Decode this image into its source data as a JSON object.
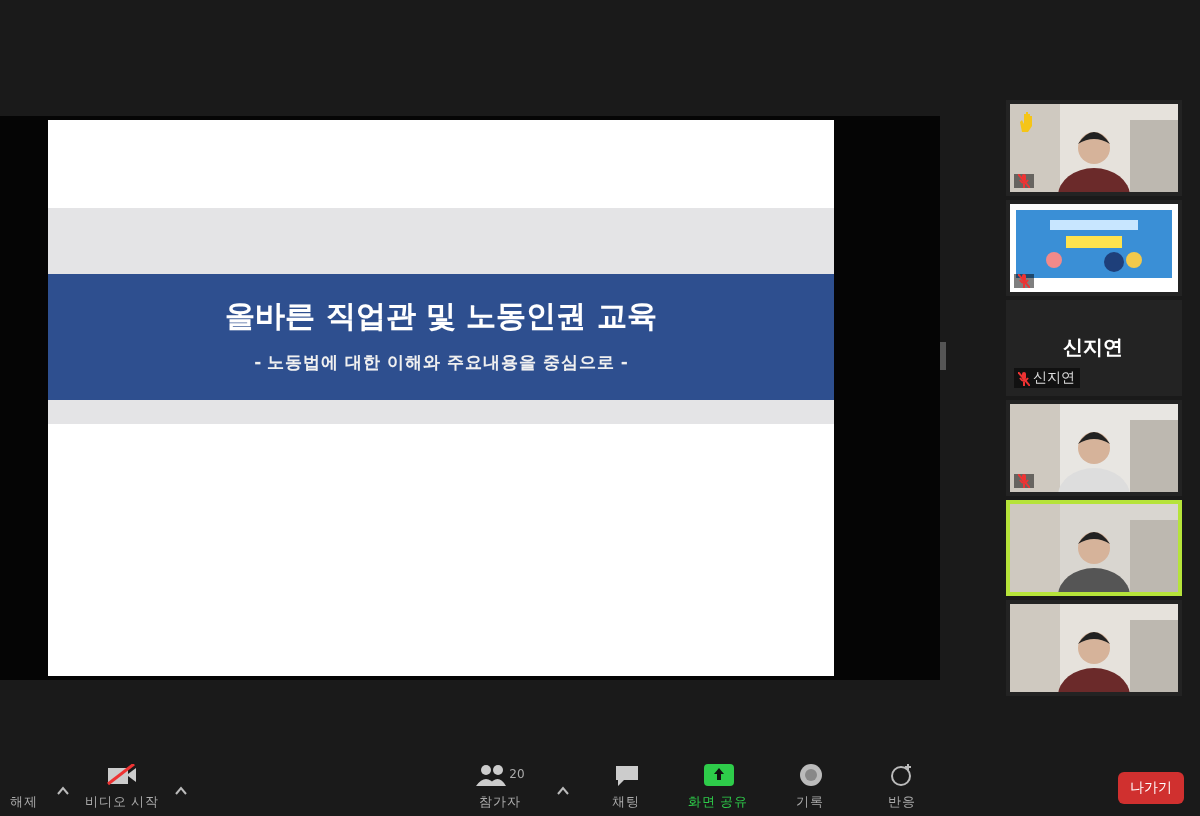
{
  "slide": {
    "title": "올바른 직업관 및 노동인권 교육",
    "subtitle": "- 노동법에 대한 이해와 주요내용을 중심으로 -"
  },
  "participants": [
    {
      "kind": "video",
      "raised_hand": true,
      "muted": true,
      "active_speaker": false
    },
    {
      "kind": "screen",
      "raised_hand": false,
      "muted": true,
      "active_speaker": false
    },
    {
      "kind": "name_only",
      "display_name": "신지연",
      "name": "신지연",
      "raised_hand": false,
      "muted": true,
      "active_speaker": false
    },
    {
      "kind": "video",
      "raised_hand": false,
      "muted": true,
      "active_speaker": false
    },
    {
      "kind": "video",
      "raised_hand": false,
      "muted": false,
      "active_speaker": true
    },
    {
      "kind": "video",
      "raised_hand": false,
      "muted": false,
      "active_speaker": false
    }
  ],
  "toolbar": {
    "left": [
      {
        "kind": "mute",
        "label": "해제"
      },
      {
        "kind": "video",
        "label": "비디오 시작"
      }
    ],
    "center": [
      {
        "kind": "participants",
        "label": "참가자",
        "count": "20",
        "highlighted": false
      },
      {
        "kind": "chat",
        "label": "채팅",
        "highlighted": false
      },
      {
        "kind": "share",
        "label": "화면 공유",
        "highlighted": true
      },
      {
        "kind": "record",
        "label": "기록",
        "highlighted": false
      },
      {
        "kind": "reactions",
        "label": "반응",
        "highlighted": false
      }
    ],
    "leave_button": "나가기"
  }
}
